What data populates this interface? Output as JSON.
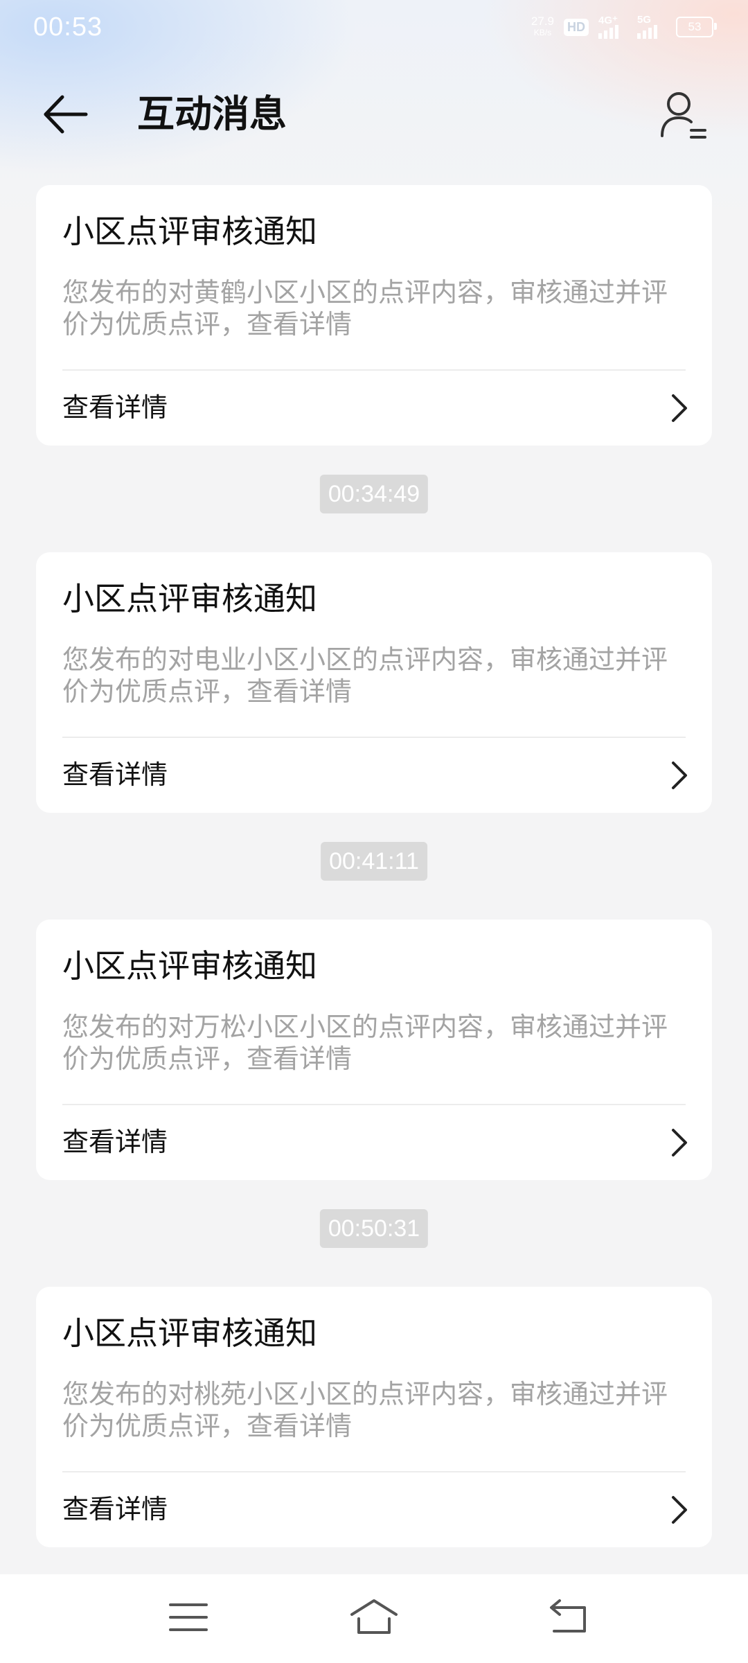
{
  "status_bar": {
    "time": "00:53",
    "net_speed_value": "27.9",
    "net_speed_unit": "KB/s",
    "hd_label": "HD",
    "signal1_label": "4G⁺",
    "signal2_label": "5G",
    "battery_level": "53"
  },
  "header": {
    "title": "互动消息",
    "back_icon": "arrow-left-icon",
    "profile_icon": "user-list-icon"
  },
  "messages": [
    {
      "title": "小区点评审核通知",
      "body": "您发布的对黄鹤小区小区的点评内容，审核通过并评价为优质点评，查看详情",
      "link_label": "查看详情"
    },
    {
      "time": "00:34:49",
      "title": "小区点评审核通知",
      "body": "您发布的对电业小区小区的点评内容，审核通过并评价为优质点评，查看详情",
      "link_label": "查看详情"
    },
    {
      "time": "00:41:11",
      "title": "小区点评审核通知",
      "body": "您发布的对万松小区小区的点评内容，审核通过并评价为优质点评，查看详情",
      "link_label": "查看详情"
    },
    {
      "time": "00:50:31",
      "title": "小区点评审核通知",
      "body": "您发布的对桃苑小区小区的点评内容，审核通过并评价为优质点评，查看详情",
      "link_label": "查看详情"
    }
  ],
  "nav_bar": {
    "menu_icon": "menu-icon",
    "home_icon": "home-icon",
    "back_icon": "back-icon"
  },
  "colors": {
    "background": "#f4f4f5",
    "card": "#ffffff",
    "body_text": "#a3a3a3",
    "time_badge": "#dadada"
  }
}
